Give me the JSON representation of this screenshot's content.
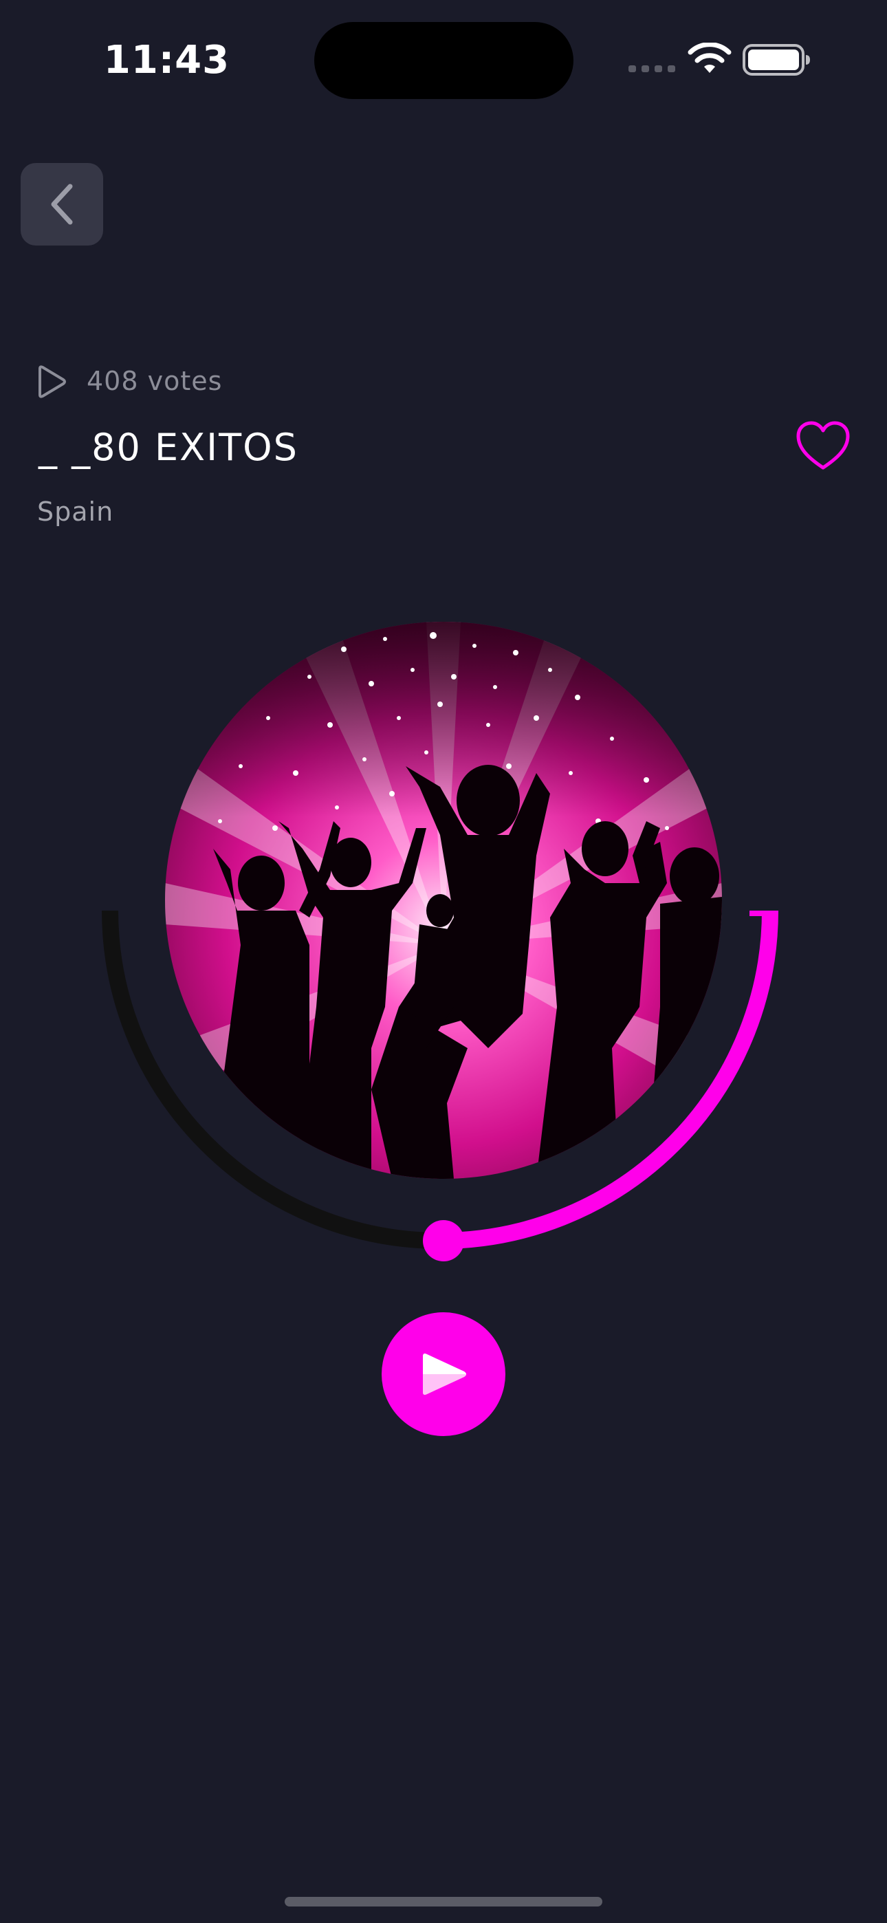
{
  "status_bar": {
    "time": "11:43"
  },
  "station": {
    "votes": "408 votes",
    "title": "_ _80 EXITOS",
    "country": "Spain",
    "favorite_icon": "heart-outline-icon"
  },
  "player": {
    "state": "paused",
    "progress": 0.5,
    "cover_description": "pink disco dancers artwork"
  },
  "colors": {
    "background": "#1a1b29",
    "accent": "#ff00ea",
    "back_button_bg": "#363746",
    "track_inactive": "#111111",
    "muted_text": "#8c8d98"
  }
}
